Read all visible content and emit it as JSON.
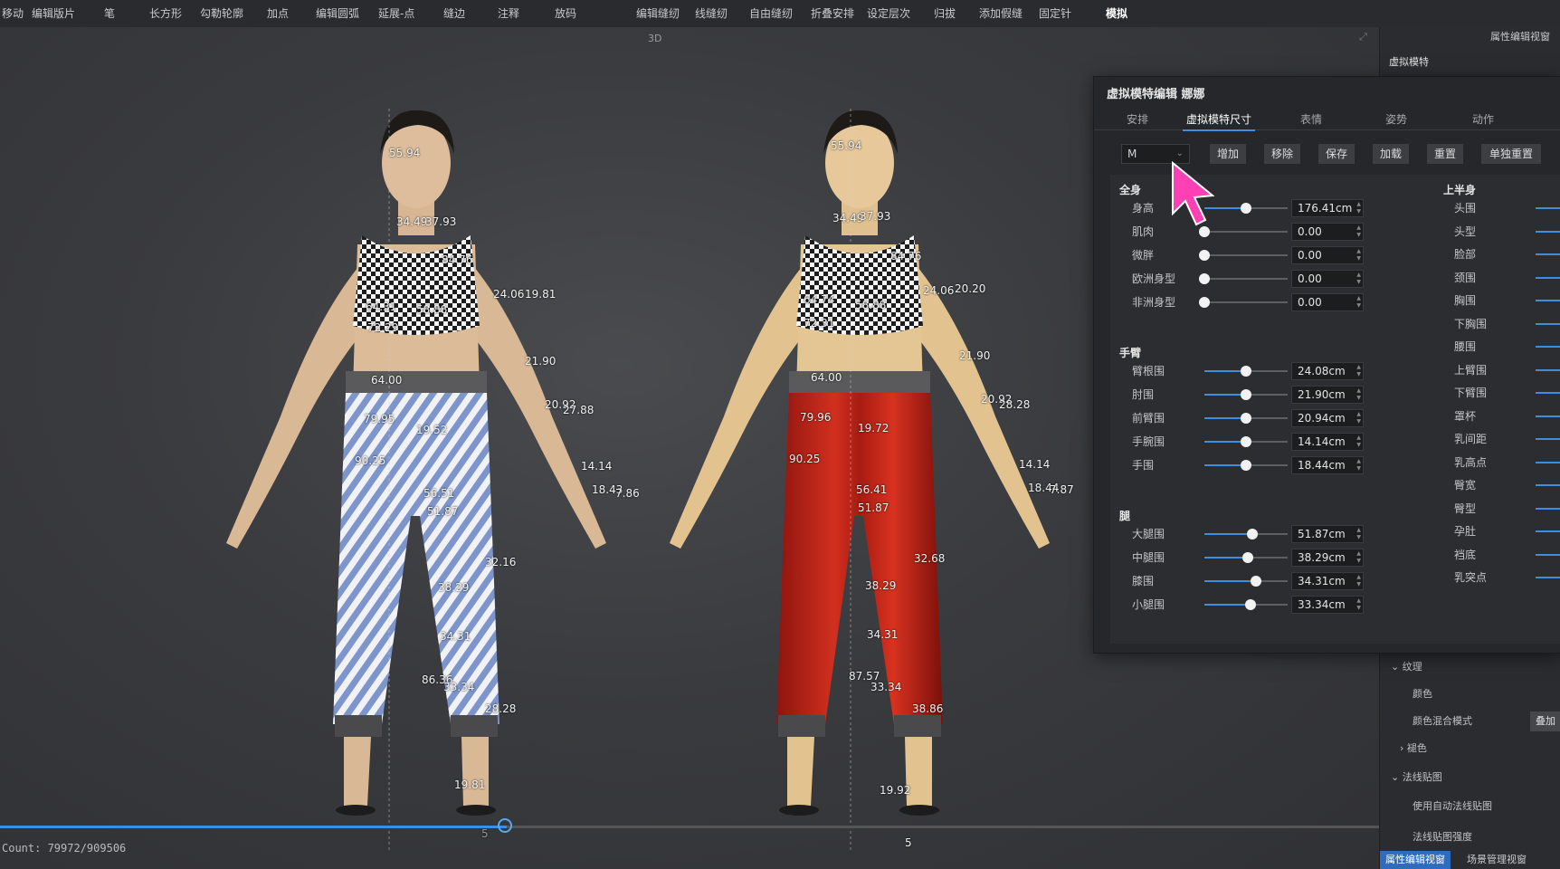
{
  "menubar": {
    "items": [
      "移动",
      "编辑版片",
      "笔",
      "长方形",
      "勾勒轮廓",
      "加点",
      "编辑圆弧",
      "延展-点",
      "缝边",
      "注释",
      "放码",
      "编辑缝纫",
      "线缝纫",
      "自由缝纫",
      "折叠安排",
      "设定层次",
      "归拔",
      "添加假缝",
      "固定针",
      "模拟"
    ],
    "active": "模拟"
  },
  "viewport": {
    "label": "3D",
    "count_text": "Count: 79972/909506",
    "timeline_marker": "5",
    "left_measurements": [
      "55.94",
      "34.49",
      "37.93",
      "84.76",
      "24.06",
      "19.81",
      "64.31",
      "58.88",
      "72.29",
      "21.90",
      "64.00",
      "20.92",
      "27.88",
      "79.95",
      "19.52",
      "90.25",
      "14.14",
      "18.43",
      "7.86",
      "56.51",
      "51.87",
      "32.16",
      "38.29",
      "34.31",
      "86.36",
      "33.34",
      "28.28",
      "19.81"
    ],
    "right_measurements": [
      "55.94",
      "34.49",
      "37.93",
      "84.76",
      "24.06",
      "20.20",
      "64.74",
      "58.88",
      "72.31",
      "21.90",
      "64.00",
      "20.92",
      "28.28",
      "79.96",
      "19.72",
      "90.25",
      "14.14",
      "18.44",
      "7.87",
      "56.41",
      "51.87",
      "32.68",
      "38.29",
      "34.31",
      "87.57",
      "33.34",
      "38.86",
      "19.92",
      "5"
    ]
  },
  "property_panel": {
    "title": "属性编辑视窗",
    "subtitle": "虚拟模特",
    "rows": [
      "纹理",
      "颜色",
      "颜色混合模式",
      "褪色",
      "法线贴图",
      "使用自动法线贴图",
      "法线贴图强度"
    ],
    "blend_value": "叠加",
    "bottom_tabs": [
      "属性编辑视窗",
      "场景管理视窗"
    ]
  },
  "dialog": {
    "title": "虚拟模特编辑 娜娜",
    "tabs": [
      "安排",
      "虚拟模特尺寸",
      "表情",
      "姿势",
      "动作"
    ],
    "active_tab": "虚拟模特尺寸",
    "size_value": "M",
    "actions": [
      "增加",
      "移除",
      "保存",
      "加载",
      "重置",
      "单独重置"
    ],
    "sections": [
      {
        "label": "全身",
        "rows": [
          {
            "name": "身高",
            "value": "176.41cm",
            "level": 0.5
          },
          {
            "name": "肌肉",
            "value": "0.00",
            "level": 0.0
          },
          {
            "name": "微胖",
            "value": "0.00",
            "level": 0.0
          },
          {
            "name": "欧洲身型",
            "value": "0.00",
            "level": 0.0
          },
          {
            "name": "非洲身型",
            "value": "0.00",
            "level": 0.0
          }
        ]
      },
      {
        "label": "手臂",
        "rows": [
          {
            "name": "臂根围",
            "value": "24.08cm",
            "level": 0.5
          },
          {
            "name": "肘围",
            "value": "21.90cm",
            "level": 0.5
          },
          {
            "name": "前臂围",
            "value": "20.94cm",
            "level": 0.5
          },
          {
            "name": "手腕围",
            "value": "14.14cm",
            "level": 0.5
          },
          {
            "name": "手围",
            "value": "18.44cm",
            "level": 0.5
          }
        ]
      },
      {
        "label": "腿",
        "rows": [
          {
            "name": "大腿围",
            "value": "51.87cm",
            "level": 0.58
          },
          {
            "name": "中腿围",
            "value": "38.29cm",
            "level": 0.52
          },
          {
            "name": "膝围",
            "value": "34.31cm",
            "level": 0.62
          },
          {
            "name": "小腿围",
            "value": "33.34cm",
            "level": 0.55
          }
        ]
      }
    ],
    "upper_body": {
      "label": "上半身",
      "items": [
        "头围",
        "头型",
        "脸部",
        "颈围",
        "胸围",
        "下胸围",
        "腰围",
        "上臂围",
        "下臂围",
        "罩杯",
        "乳间距",
        "乳高点",
        "臀宽",
        "臀型",
        "孕肚",
        "裆底",
        "乳突点"
      ]
    }
  },
  "colors": {
    "accent": "#3d8ee0",
    "cursor": "#ff3fb4",
    "pants_left": "#8fa6d6",
    "pants_right": "#c42218"
  }
}
